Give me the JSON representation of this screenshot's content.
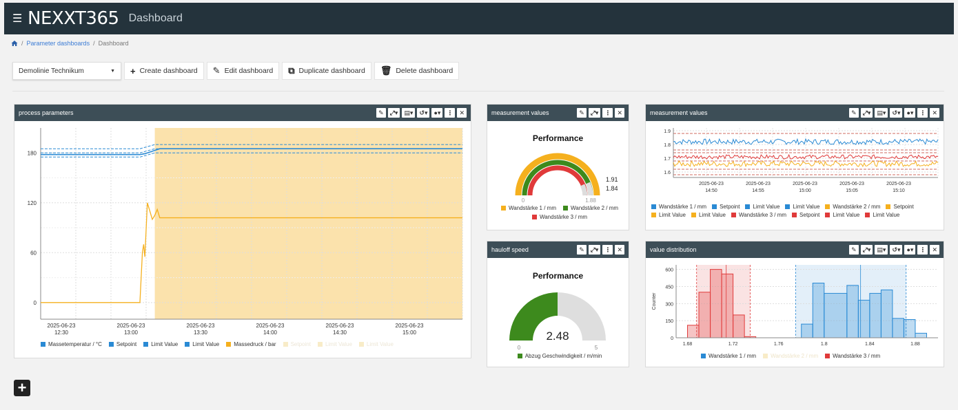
{
  "app": {
    "logo": "NEXXT365",
    "title": "Dashboard",
    "menu_icon": "hamburger-icon"
  },
  "breadcrumb": {
    "items": [
      "Parameter dashboards",
      "Dashboard"
    ],
    "sep": "/"
  },
  "toolbar": {
    "select_value": "Demolinie Technikum",
    "create": "Create dashboard",
    "edit": "Edit dashboard",
    "duplicate": "Duplicate dashboard",
    "delete": "Delete dashboard"
  },
  "colors": {
    "header": "#24333c",
    "panel_head": "#3d4e57",
    "blue": "#2a8ad4",
    "orange": "#f5b01e",
    "green": "#3d8a1d",
    "red": "#e03a3a",
    "highlight": "#fbe2ac"
  },
  "panels": {
    "process": {
      "title": "process parameters",
      "legend": [
        "Massetemperatur / °C",
        "Setpoint",
        "Limit Value",
        "Limit Value",
        "Massedruck / bar",
        "Setpoint",
        "Limit Value",
        "Limit Value"
      ]
    },
    "mv1": {
      "title": "measurement values",
      "gauge_title": "Performance",
      "min": "0",
      "max": "1.88",
      "val1": "1.91",
      "val2": "1.84",
      "legend": [
        "Wandstärke 1 / mm",
        "Wandstärke 2 / mm",
        "Wandstärke 3 / mm"
      ]
    },
    "mv2": {
      "title": "measurement values",
      "legend": [
        "Wandstärke 1 / mm",
        "Setpoint",
        "Limit Value",
        "Limit Value",
        "Wandstärke 2 / mm",
        "Setpoint",
        "Limit Value",
        "Limit Value",
        "Wandstärke 3 / mm",
        "Setpoint",
        "Limit Value",
        "Limit Value"
      ]
    },
    "haul": {
      "title": "hauloff speed",
      "gauge_title": "Performance",
      "value": "2.48",
      "min": "0",
      "max": "5",
      "legend": [
        "Abzug Geschwindigkeit / m/min"
      ]
    },
    "dist": {
      "title": "value distribution",
      "ylabel": "Counter",
      "legend": [
        "Wandstärke 1 / mm",
        "Wandstärke 2 / mm",
        "Wandstärke 3 / mm"
      ]
    }
  },
  "chart_data": [
    {
      "type": "line",
      "name_ref": "process",
      "x_ticks": [
        "2025-06-23\n12:30",
        "2025-06-23\n13:00",
        "2025-06-23\n13:30",
        "2025-06-23\n14:00",
        "2025-06-23\n14:30",
        "2025-06-23\n15:00"
      ],
      "y_ticks": [
        0,
        60,
        120,
        180
      ],
      "ylim": [
        -20,
        210
      ],
      "xlim": [
        0,
        170
      ],
      "highlight_range": [
        46,
        170
      ],
      "series": [
        {
          "name": "Massetemperatur / °C",
          "x": [
            0,
            40,
            42,
            46,
            48,
            170
          ],
          "y": [
            178,
            178,
            179,
            183,
            185,
            185
          ]
        },
        {
          "name": "Setpoint",
          "x": [
            0,
            40,
            46,
            170
          ],
          "y": [
            180,
            180,
            185,
            185
          ]
        },
        {
          "name": "Limit Value",
          "x": [
            0,
            40,
            46,
            170
          ],
          "y": [
            185,
            185,
            190,
            190
          ]
        },
        {
          "name": "Limit Value",
          "x": [
            0,
            40,
            46,
            170
          ],
          "y": [
            175,
            175,
            180,
            180
          ]
        },
        {
          "name": "Massedruck / bar",
          "x": [
            0,
            40,
            40.5,
            41,
            41.5,
            42,
            43,
            44,
            45,
            46,
            47,
            48,
            170
          ],
          "y": [
            0,
            0,
            30,
            60,
            70,
            55,
            120,
            110,
            100,
            105,
            112,
            102,
            102
          ]
        }
      ]
    },
    {
      "type": "line",
      "name_ref": "mv2",
      "x_ticks": [
        "2025-06-23\n14:50",
        "2025-06-23\n14:55",
        "2025-06-23\n15:00",
        "2025-06-23\n15:05",
        "2025-06-23\n15:10"
      ],
      "y_ticks": [
        1.6,
        1.7,
        1.8,
        1.9
      ],
      "ylim": [
        1.56,
        1.92
      ],
      "series": [
        {
          "name": "Wandstärke 1 / mm",
          "mean": 1.82,
          "noise": 0.02
        },
        {
          "name": "Wandstärke 2 / mm",
          "mean": 1.66,
          "noise": 0.02
        },
        {
          "name": "Wandstärke 3 / mm",
          "mean": 1.71,
          "noise": 0.015
        }
      ]
    },
    {
      "type": "bar",
      "name_ref": "dist",
      "x_ticks": [
        1.68,
        1.72,
        1.76,
        1.8,
        1.84,
        1.88
      ],
      "y_ticks": [
        0,
        150,
        300,
        450,
        600
      ],
      "xlim": [
        1.67,
        1.9
      ],
      "ylim": [
        0,
        640
      ],
      "series": [
        {
          "name": "Wandstärke 3 / mm",
          "bins": [
            [
              1.68,
              1.69,
              110
            ],
            [
              1.69,
              1.7,
              400
            ],
            [
              1.7,
              1.71,
              600
            ],
            [
              1.71,
              1.72,
              560
            ],
            [
              1.72,
              1.73,
              200
            ],
            [
              1.73,
              1.74,
              10
            ]
          ]
        },
        {
          "name": "Wandstärke 1 / mm",
          "bins": [
            [
              1.78,
              1.79,
              120
            ],
            [
              1.79,
              1.8,
              480
            ],
            [
              1.8,
              1.82,
              390
            ],
            [
              1.82,
              1.83,
              460
            ],
            [
              1.83,
              1.84,
              330
            ],
            [
              1.84,
              1.85,
              390
            ],
            [
              1.85,
              1.86,
              420
            ],
            [
              1.86,
              1.87,
              170
            ],
            [
              1.87,
              1.88,
              160
            ],
            [
              1.88,
              1.89,
              40
            ]
          ]
        }
      ]
    }
  ]
}
